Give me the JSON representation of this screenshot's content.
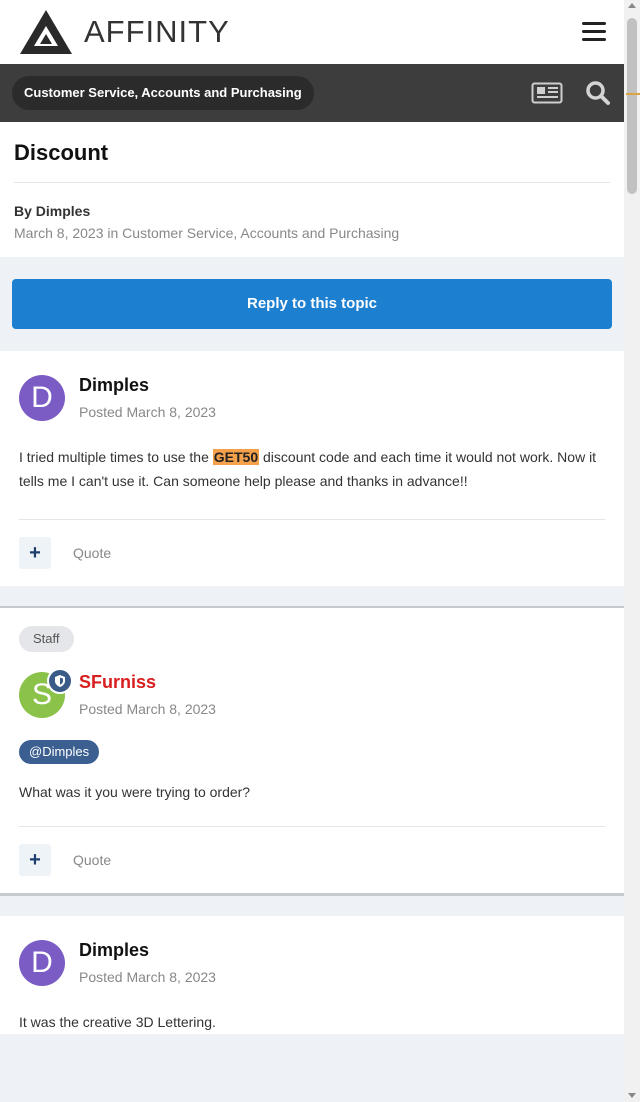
{
  "header": {
    "logo_text": "AFFINITY",
    "menu_icon": "hamburger-menu-icon"
  },
  "nav": {
    "breadcrumb": "Customer Service, Accounts and Purchasing",
    "news_icon": "newspaper-icon",
    "search_icon": "search-icon"
  },
  "topic": {
    "title": "Discount",
    "by_line": "By Dimples",
    "meta": "March 8, 2023 in Customer Service, Accounts and Purchasing",
    "reply_label": "Reply to this topic"
  },
  "posts": [
    {
      "avatar_letter": "D",
      "avatar_color": "#7a5cc4",
      "author": "Dimples",
      "date": "Posted March 8, 2023",
      "body_before": "I tried multiple times to use the ",
      "body_highlight": "GET50",
      "body_after": " discount code and each time it would not work. Now it tells me I can't use it. Can someone help please and thanks in advance!!",
      "plus_label": "+",
      "quote_label": "Quote"
    },
    {
      "tag": "Staff",
      "avatar_letter": "S",
      "avatar_color": "#8bc34a",
      "author": "SFurniss",
      "author_color": "#d81e1e",
      "date": "Posted March 8, 2023",
      "mention": "@Dimples",
      "body": "What was it you were trying to order?",
      "plus_label": "+",
      "quote_label": "Quote"
    },
    {
      "avatar_letter": "D",
      "avatar_color": "#7a5cc4",
      "author": "Dimples",
      "date": "Posted March 8, 2023",
      "body": "It was the creative 3D Lettering."
    }
  ],
  "colors": {
    "reply_button": "#1d7fd0",
    "navbar": "#3d3d3d",
    "mention": "#3c5f92",
    "highlight": "#f5a04a"
  }
}
